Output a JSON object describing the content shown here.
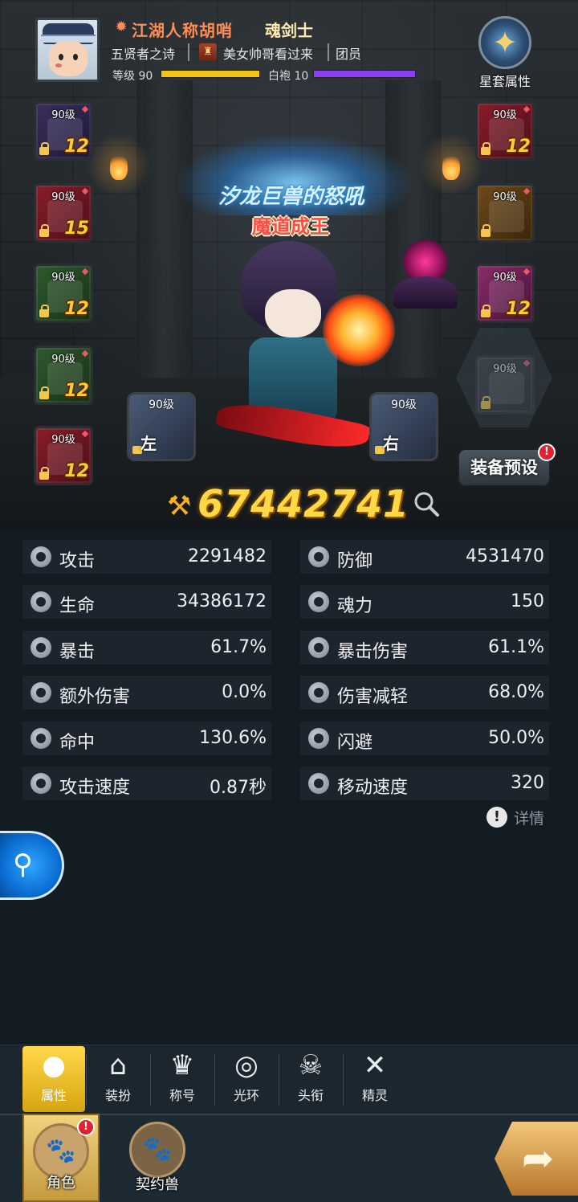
{
  "player": {
    "name": "江湖人称胡哨",
    "class": "魂剑士",
    "title": "五贤者之诗",
    "guild": "美女帅哥看过来",
    "guild_role": "团员",
    "level_label": "等级 90",
    "level_progress": 1.0,
    "robe_label": "白袍 10",
    "robe_progress": 1.0
  },
  "starset": {
    "label": "星套属性"
  },
  "equipment_left": [
    {
      "level": "90级",
      "plus": "12",
      "color": "purple",
      "icon": "helmet-icon"
    },
    {
      "level": "90级",
      "plus": "15",
      "color": "red",
      "icon": "chest-armor-icon"
    },
    {
      "level": "90级",
      "plus": "12",
      "color": "green",
      "icon": "shoulder-icon"
    },
    {
      "level": "90级",
      "plus": "12",
      "color": "green",
      "icon": "gloves-icon"
    },
    {
      "level": "90级",
      "plus": "12",
      "color": "red",
      "icon": "boots-icon"
    }
  ],
  "equipment_right": [
    {
      "level": "90级",
      "plus": "12",
      "color": "red",
      "icon": "weapon-icon"
    },
    {
      "level": "90级",
      "plus": "",
      "color": "gold",
      "icon": "ring-icon"
    },
    {
      "level": "90级",
      "plus": "12",
      "color": "pink",
      "icon": "necklace-icon"
    },
    {
      "level": "90级",
      "plus": "",
      "color": "gray",
      "icon": "wings-back-icon"
    }
  ],
  "hand_slots": {
    "left": {
      "level": "90级",
      "side": "左"
    },
    "right": {
      "level": "90级",
      "side": "右"
    }
  },
  "hero": {
    "title_banner": "汐龙巨兽的怒吼",
    "sub_banner": "魔道成王"
  },
  "preset_button": "装备预设",
  "combat_power": "67442741",
  "stats": [
    {
      "name": "攻击",
      "value": "2291482",
      "icon": "sword-icon"
    },
    {
      "name": "防御",
      "value": "4531470",
      "icon": "shield-icon"
    },
    {
      "name": "生命",
      "value": "34386172",
      "icon": "heart-icon"
    },
    {
      "name": "魂力",
      "value": "150",
      "icon": "soul-icon"
    },
    {
      "name": "暴击",
      "value": "61.7%",
      "icon": "critical-icon"
    },
    {
      "name": "暴击伤害",
      "value": "61.1%",
      "icon": "critical-damage-icon"
    },
    {
      "name": "额外伤害",
      "value": "0.0%",
      "icon": "extra-damage-icon"
    },
    {
      "name": "伤害减轻",
      "value": "68.0%",
      "icon": "damage-reduction-icon"
    },
    {
      "name": "命中",
      "value": "130.6%",
      "icon": "target-icon"
    },
    {
      "name": "闪避",
      "value": "50.0%",
      "icon": "dodge-icon"
    },
    {
      "name": "攻击速度",
      "value": "0.87秒",
      "icon": "attack-speed-icon"
    },
    {
      "name": "移动速度",
      "value": "320",
      "icon": "move-speed-icon"
    }
  ],
  "detail_link": "详情",
  "tabs": [
    {
      "label": "属性",
      "icon": "person-icon",
      "active": true
    },
    {
      "label": "装扮",
      "icon": "hanger-icon",
      "active": false
    },
    {
      "label": "称号",
      "icon": "crown-icon",
      "active": false
    },
    {
      "label": "光环",
      "icon": "halo-icon",
      "active": false
    },
    {
      "label": "头衔",
      "icon": "skull-crest-icon",
      "active": false
    },
    {
      "label": "精灵",
      "icon": "fairy-icon",
      "active": false
    }
  ],
  "bottom_nav": [
    {
      "label": "角色",
      "active": true
    },
    {
      "label": "契约兽",
      "active": false
    }
  ],
  "colors": {
    "power": "#ffd845",
    "name": "#ff8c55",
    "level_bar": "#f2c417",
    "robe_bar": "#8a3ff0",
    "tab_active": "#ffd84a"
  }
}
